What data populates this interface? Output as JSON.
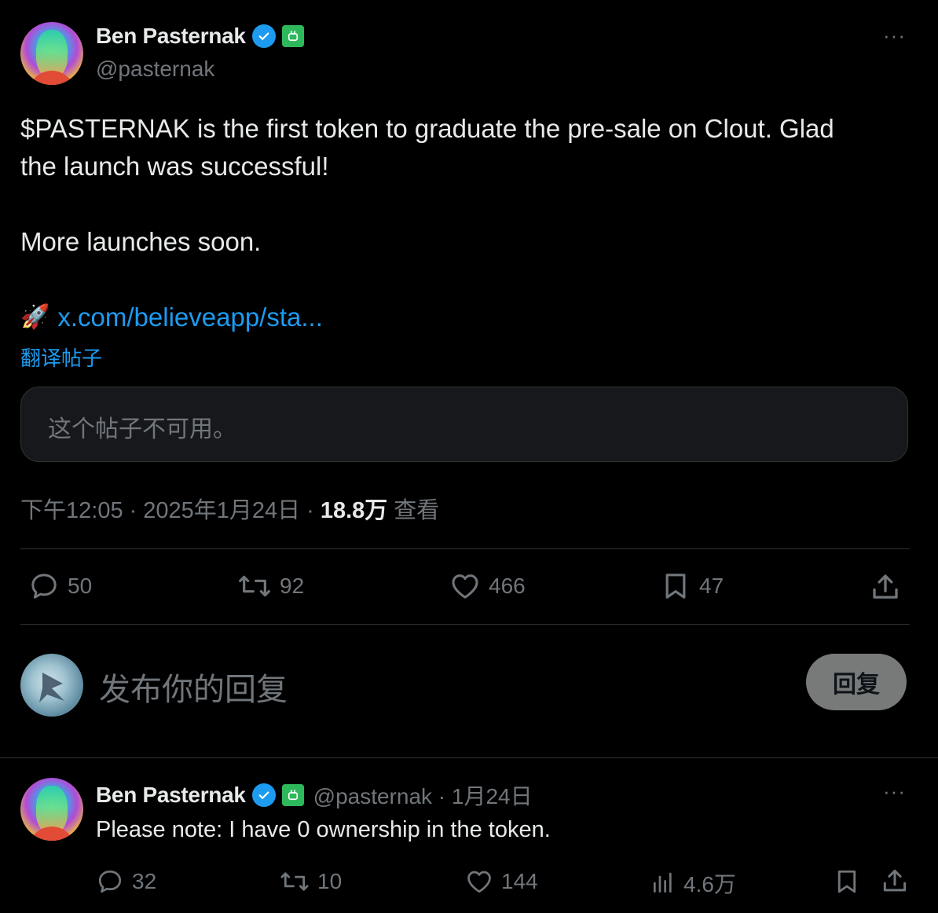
{
  "tweet": {
    "author_name": "Ben Pasternak",
    "author_handle": "@pasternak",
    "text_line1": "$PASTERNAK is the first token to graduate the pre-sale on Clout. Glad",
    "text_line2": "the launch was successful!",
    "text_line3": "More launches soon.",
    "link_emoji": "🚀",
    "link_text": "x.com/believeapp/sta...",
    "translate_label": "翻译帖子",
    "quoted_unavailable": "这个帖子不可用。",
    "time": "下午12:05",
    "date": "2025年1月24日",
    "views_count": "18.8万",
    "views_label": "查看",
    "separator": "·",
    "stats": {
      "replies": "50",
      "reposts": "92",
      "likes": "466",
      "bookmarks": "47"
    },
    "more_label": "···"
  },
  "composer": {
    "placeholder": "发布你的回复",
    "reply_button": "回复"
  },
  "reply": {
    "author_name": "Ben Pasternak",
    "author_handle_date": "@pasternak · 1月24日",
    "text": "Please note: I have 0 ownership in the token.",
    "stats": {
      "replies": "32",
      "reposts": "10",
      "likes": "144",
      "views": "4.6万"
    },
    "more_label": "···"
  },
  "colors": {
    "background": "#000000",
    "text": "#e7e9ea",
    "muted": "#71767b",
    "accent": "#1d9bf0",
    "divider": "#2f3336"
  },
  "icons": [
    "verified-icon",
    "bot-badge-icon",
    "more-icon",
    "reply-icon",
    "repost-icon",
    "like-icon",
    "bookmark-icon",
    "share-icon",
    "views-icon"
  ]
}
